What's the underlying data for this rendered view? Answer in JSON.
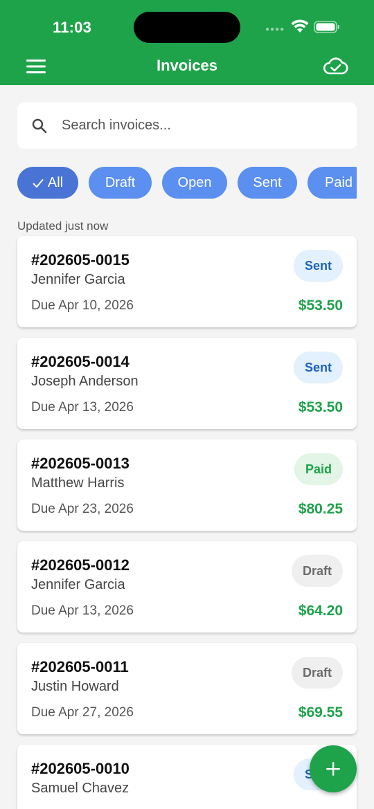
{
  "status_bar": {
    "time": "11:03"
  },
  "header": {
    "title": "Invoices"
  },
  "search": {
    "placeholder": "Search invoices..."
  },
  "filters": [
    {
      "label": "All",
      "active": true
    },
    {
      "label": "Draft",
      "active": false
    },
    {
      "label": "Open",
      "active": false
    },
    {
      "label": "Sent",
      "active": false
    },
    {
      "label": "Paid",
      "active": false
    }
  ],
  "updated_text": "Updated just now",
  "invoices": [
    {
      "number": "#202605-0015",
      "customer": "Jennifer Garcia",
      "due": "Due Apr 10, 2026",
      "amount": "$53.50",
      "status": "Sent"
    },
    {
      "number": "#202605-0014",
      "customer": "Joseph Anderson",
      "due": "Due Apr 13, 2026",
      "amount": "$53.50",
      "status": "Sent"
    },
    {
      "number": "#202605-0013",
      "customer": "Matthew Harris",
      "due": "Due Apr 23, 2026",
      "amount": "$80.25",
      "status": "Paid"
    },
    {
      "number": "#202605-0012",
      "customer": "Jennifer Garcia",
      "due": "Due Apr 13, 2026",
      "amount": "$64.20",
      "status": "Draft"
    },
    {
      "number": "#202605-0011",
      "customer": "Justin Howard",
      "due": "Due Apr 27, 2026",
      "amount": "$69.55",
      "status": "Draft"
    },
    {
      "number": "#202605-0010",
      "customer": "Samuel Chavez",
      "due": "",
      "amount": "",
      "status": "Sent"
    }
  ],
  "colors": {
    "brand_green": "#1ea34a",
    "chip_blue": "#5b8ff0",
    "chip_active": "#4a73d6",
    "sent_text": "#1c64b8",
    "draft_text": "#6b6b6b"
  },
  "icons": {
    "menu": "hamburger-icon",
    "sync": "cloud-check-icon",
    "search": "search-icon",
    "check": "check-icon",
    "add": "plus-icon"
  }
}
